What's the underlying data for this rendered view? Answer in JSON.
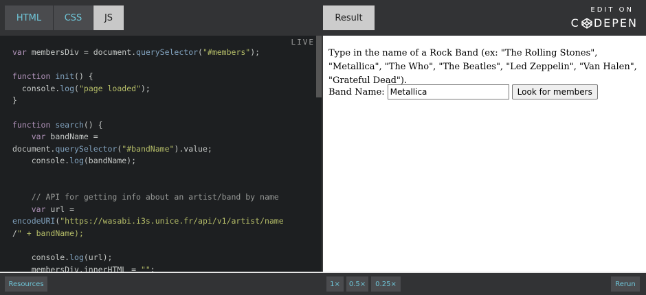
{
  "tabs": [
    {
      "label": "HTML"
    },
    {
      "label": "CSS"
    },
    {
      "label": "JS"
    }
  ],
  "result_tab": "Result",
  "branding": {
    "edit_on": "EDIT ON",
    "left": "C",
    "right": "DEPEN"
  },
  "editor": {
    "live_label": "LIVE",
    "lines": [
      "var membersDiv = document.querySelector(\"#members\");",
      "",
      "function init() {",
      "  console.log(\"page loaded\");",
      "}",
      "",
      "function search() {",
      "    var bandName =",
      "document.querySelector(\"#bandName\").value;",
      "    console.log(bandName);",
      "",
      "",
      "    // API for getting info about an artist/band by name",
      "    var url =",
      "encodeURI(\"https://wasabi.i3s.unice.fr/api/v1/artist/name",
      "/\" + bandName);",
      "",
      "    console.log(url);",
      "    membersDiv.innerHTML = \"\";"
    ]
  },
  "result": {
    "instructions": "Type in the name of a Rock Band (ex: \"The Rolling Stones\", \"Metallica\", \"The Who\", \"The Beatles\", \"Led Zeppelin\", \"Van Halen\", \"Grateful Dead\").",
    "band_label": "Band Name:",
    "band_value": "Metallica",
    "button_label": "Look for members"
  },
  "bottom": {
    "resources": "Resources",
    "zoom": [
      "1×",
      "0.5×",
      "0.25×"
    ],
    "rerun": "Rerun"
  }
}
